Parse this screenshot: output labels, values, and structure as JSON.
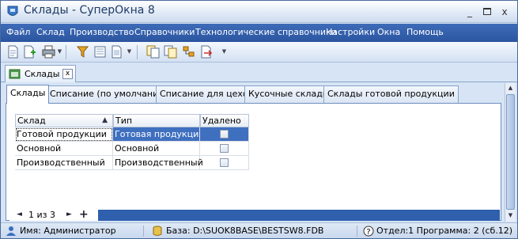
{
  "window": {
    "title": "Склады - СуперОкна 8",
    "minimize": "_",
    "close": "x"
  },
  "menu": {
    "items": [
      "Файл",
      "Склад",
      "Производство",
      "Справочники",
      "Технологические справочники",
      "Настройки",
      "Окна",
      "Помощь"
    ]
  },
  "toolbar": {
    "icons": [
      "new-document-icon",
      "add-document-icon",
      "print-icon",
      "filter-icon",
      "list-view-icon",
      "document-icon",
      "copy-icon",
      "copy-list-icon",
      "tree-icon",
      "export-icon"
    ]
  },
  "document_tab": {
    "label": "Склады",
    "close": "x"
  },
  "sub_tabs": [
    "Склады",
    "Списание (по умолчанию)",
    "Списание для цехов",
    "Кусочные склады",
    "Склады готовой продукции"
  ],
  "grid": {
    "columns": [
      "Склад",
      "Тип",
      "Удалено"
    ],
    "sort_indicator": "▲",
    "rows": [
      {
        "name": "Готовой продукции",
        "type": "Готовая продукция",
        "deleted": false
      },
      {
        "name": "Основной",
        "type": "Основной",
        "deleted": false
      },
      {
        "name": "Производственный",
        "type": "Производственный",
        "deleted": false
      }
    ]
  },
  "navigator": {
    "first": "◄",
    "position": "1 из 3",
    "next": "►",
    "add": "+"
  },
  "statusbar": {
    "user": "Имя: Администратор",
    "database": "База: D:\\SUOK8BASE\\BESTSW8.FDB",
    "info": "Отдел:1 Программа: 2 (сб.12)"
  },
  "colors": {
    "menubar": "#2f5fad",
    "selection": "#3f6fbf",
    "window_bg": "#d6e4f5"
  }
}
